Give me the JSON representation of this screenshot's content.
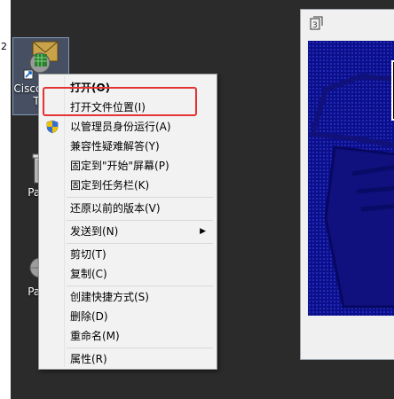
{
  "desktop": {
    "edge_number": "2",
    "icons": [
      {
        "label": "Cisco Pa... T..."
      },
      {
        "label": "Pack"
      },
      {
        "label": "Pack"
      }
    ]
  },
  "context_menu": {
    "items": [
      {
        "label": "打开(O)"
      },
      {
        "label": "打开文件位置(I)"
      },
      {
        "label": "以管理员身份运行(A)"
      },
      {
        "label": "兼容性疑难解答(Y)"
      },
      {
        "label": "固定到\"开始\"屏幕(P)"
      },
      {
        "label": "固定到任务栏(K)"
      },
      {
        "label": "还原以前的版本(V)"
      },
      {
        "label": "发送到(N)"
      },
      {
        "label": "剪切(T)"
      },
      {
        "label": "复制(C)"
      },
      {
        "label": "创建快捷方式(S)"
      },
      {
        "label": "删除(D)"
      },
      {
        "label": "重命名(M)"
      },
      {
        "label": "属性(R)"
      }
    ],
    "highlight_color": "#e53232"
  },
  "colors": {
    "desktop_bg": "#2b2b2b",
    "menu_bg": "#f2f2f2",
    "window_canvas": "#0c0f8a"
  }
}
